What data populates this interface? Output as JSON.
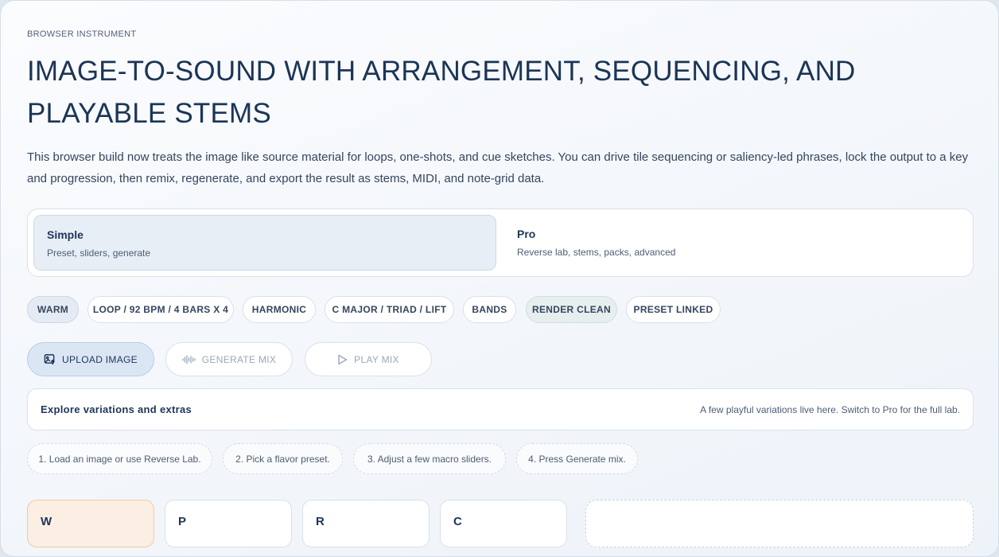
{
  "header": {
    "eyebrow": "BROWSER INSTRUMENT",
    "title": "IMAGE-TO-SOUND WITH ARRANGEMENT, SEQUENCING, AND PLAYABLE STEMS",
    "description": "This browser build now treats the image like source material for loops, one-shots, and cue sketches. You can drive tile sequencing or saliency-led phrases, lock the output to a key and progression, then remix, regenerate, and export the result as stems, MIDI, and note-grid data."
  },
  "modes": [
    {
      "title": "Simple",
      "subtitle": "Preset, sliders, generate",
      "selected": true
    },
    {
      "title": "Pro",
      "subtitle": "Reverse lab, stems, packs, advanced",
      "selected": false
    }
  ],
  "chips": [
    "WARM",
    "LOOP / 92 BPM / 4 BARS X 4",
    "HARMONIC",
    "C MAJOR / TRIAD / LIFT",
    "BANDS",
    "RENDER CLEAN",
    "PRESET LINKED"
  ],
  "actions": {
    "upload": "UPLOAD IMAGE",
    "generate": "GENERATE MIX",
    "play": "PLAY MIX"
  },
  "explore": {
    "title": "Explore variations and extras",
    "note": "A few playful variations live here. Switch to Pro for the full lab."
  },
  "steps": [
    "1. Load an image or use Reverse Lab.",
    "2. Pick a flavor preset.",
    "3. Adjust a few macro sliders.",
    "4. Press Generate mix."
  ],
  "cards": [
    "W",
    "P",
    "R",
    "C"
  ],
  "colors": {
    "accent": "#1d3557",
    "primary_button": "#dbe6f5",
    "warm_card": "#fbeee3"
  }
}
